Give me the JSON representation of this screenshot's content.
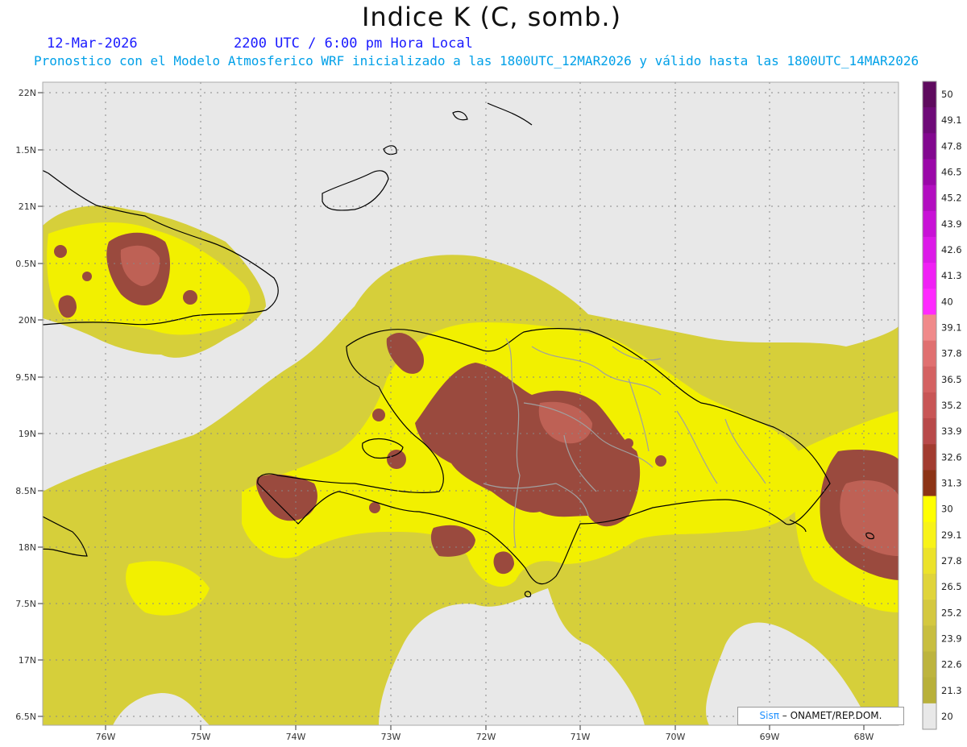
{
  "header": {
    "title": "Indice K (C, somb.)",
    "date": "12-Mar-2026",
    "time": "2200 UTC / 6:00 pm Hora Local",
    "subtitle": "Pronostico con el Modelo Atmosferico WRF inicializado a las 1800UTC_12MAR2026 y válido hasta las  1800UTC_14MAR2026"
  },
  "axes": {
    "lat_labels": [
      "22N",
      "1.5N",
      "21N",
      "0.5N",
      "20N",
      "9.5N",
      "19N",
      "8.5N",
      "18N",
      "7.5N",
      "17N",
      "6.5N"
    ],
    "lon_labels": [
      "76W",
      "75W",
      "74W",
      "73W",
      "72W",
      "71W",
      "70W",
      "69W",
      "68W"
    ]
  },
  "colorbar": {
    "labels": [
      "50",
      "49.1",
      "47.8",
      "46.5",
      "45.2",
      "43.9",
      "42.6",
      "41.3",
      "40",
      "39.1",
      "37.8",
      "36.5",
      "35.2",
      "33.9",
      "32.6",
      "31.3",
      "30",
      "29.1",
      "27.8",
      "26.5",
      "25.2",
      "23.9",
      "22.6",
      "21.3",
      "20"
    ],
    "colors": [
      "#5e0a5e",
      "#6e0a78",
      "#82088f",
      "#9a08a8",
      "#b20ec0",
      "#c812d6",
      "#dc1ae8",
      "#f020f5",
      "#ff2aff",
      "#f08a8a",
      "#e07070",
      "#d46262",
      "#c85656",
      "#b84a4a",
      "#a23c30",
      "#8c3416",
      "#ffff00",
      "#f8f318",
      "#ece22a",
      "#e0d43a",
      "#d4c840",
      "#c8be40",
      "#bdb43e",
      "#b8b03a",
      "#e8e8e8"
    ]
  },
  "map_colors": {
    "background": "#e8e8e8",
    "yellow": "#f2f000",
    "olive": "#d6cf3a",
    "brown": "#9a4a3e",
    "salmon": "#c96a5e",
    "coast": "#000000",
    "border": "#a0a0a0"
  },
  "credit": {
    "sis": "Sisπ",
    "text": "– ONAMET/REP.DOM."
  }
}
